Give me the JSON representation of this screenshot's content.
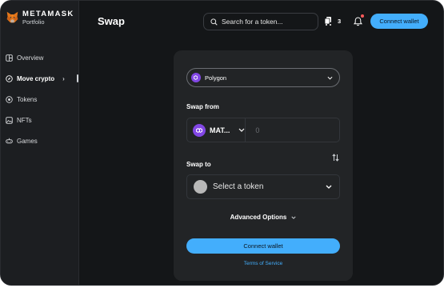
{
  "brand": {
    "name": "METAMASK",
    "subtitle": "Portfolio",
    "logo_icon": "metamask-fox-icon"
  },
  "sidebar": {
    "items": [
      {
        "label": "Overview",
        "icon": "overview-icon",
        "active": false
      },
      {
        "label": "Move crypto",
        "icon": "compass-icon",
        "active": true
      },
      {
        "label": "Tokens",
        "icon": "tokens-icon",
        "active": false
      },
      {
        "label": "NFTs",
        "icon": "nfts-icon",
        "active": false
      },
      {
        "label": "Games",
        "icon": "gamepad-icon",
        "active": false
      }
    ]
  },
  "header": {
    "title": "Swap",
    "search_placeholder": "Search for a token...",
    "cart_count": "3",
    "connect_label": "Connect wallet"
  },
  "swap": {
    "network": "Polygon",
    "from_label": "Swap from",
    "from_token": "MAT...",
    "from_amount_placeholder": "0",
    "to_label": "Swap to",
    "to_placeholder": "Select a token",
    "advanced_label": "Advanced Options",
    "connect_label": "Connect wallet",
    "terms_label": "Terms of Service"
  },
  "colors": {
    "accent": "#43aefc",
    "polygon": "#8247e5",
    "background": "#141618",
    "card": "#222426"
  }
}
